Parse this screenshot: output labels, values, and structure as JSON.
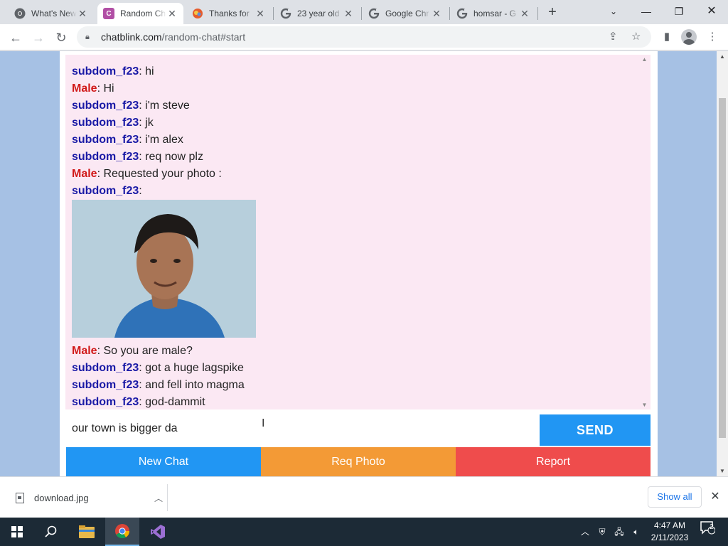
{
  "browser": {
    "tabs": [
      {
        "title": "What's New",
        "icon": "chrome-icon"
      },
      {
        "title": "Random Chat",
        "icon": "chatblink-icon",
        "active": true
      },
      {
        "title": "Thanks for",
        "icon": "colorful-icon"
      },
      {
        "title": "23 year old",
        "icon": "google-icon"
      },
      {
        "title": "Google Chr",
        "icon": "google-icon"
      },
      {
        "title": "homsar - G",
        "icon": "google-icon"
      }
    ],
    "url_host": "chatblink.com",
    "url_path": "/random-chat#start"
  },
  "chat": {
    "messages": [
      {
        "name": "subdom_f23",
        "role": "stranger",
        "text": "hi"
      },
      {
        "name": "Male",
        "role": "you",
        "text": "Hi"
      },
      {
        "name": "subdom_f23",
        "role": "stranger",
        "text": "i'm steve"
      },
      {
        "name": "subdom_f23",
        "role": "stranger",
        "text": "jk"
      },
      {
        "name": "subdom_f23",
        "role": "stranger",
        "text": "i'm alex"
      },
      {
        "name": "subdom_f23",
        "role": "stranger",
        "text": "req now plz"
      },
      {
        "name": "Male",
        "role": "you",
        "text": "Requested your photo :"
      },
      {
        "name": "subdom_f23",
        "role": "stranger",
        "text": ""
      },
      {
        "name": "Male",
        "role": "you",
        "text": "So you are male?"
      },
      {
        "name": "subdom_f23",
        "role": "stranger",
        "text": "got a huge lagspike"
      },
      {
        "name": "subdom_f23",
        "role": "stranger",
        "text": "and fell into magma"
      },
      {
        "name": "subdom_f23",
        "role": "stranger",
        "text": "god-dammit"
      }
    ],
    "separator": ": ",
    "input_value": "our town is bigger da",
    "send_label": "SEND",
    "new_chat_label": "New Chat",
    "req_photo_label": "Req Photo",
    "report_label": "Report",
    "colors": {
      "stranger": "#1a1aa6",
      "you": "#d11a1a",
      "log_bg": "#fbe8f3",
      "page_bg": "#a6c1e4"
    }
  },
  "downloads": {
    "file_name": "download.jpg",
    "show_all_label": "Show all"
  },
  "taskbar": {
    "time": "4:47 AM",
    "date": "2/11/2023",
    "notification_count": "2"
  }
}
